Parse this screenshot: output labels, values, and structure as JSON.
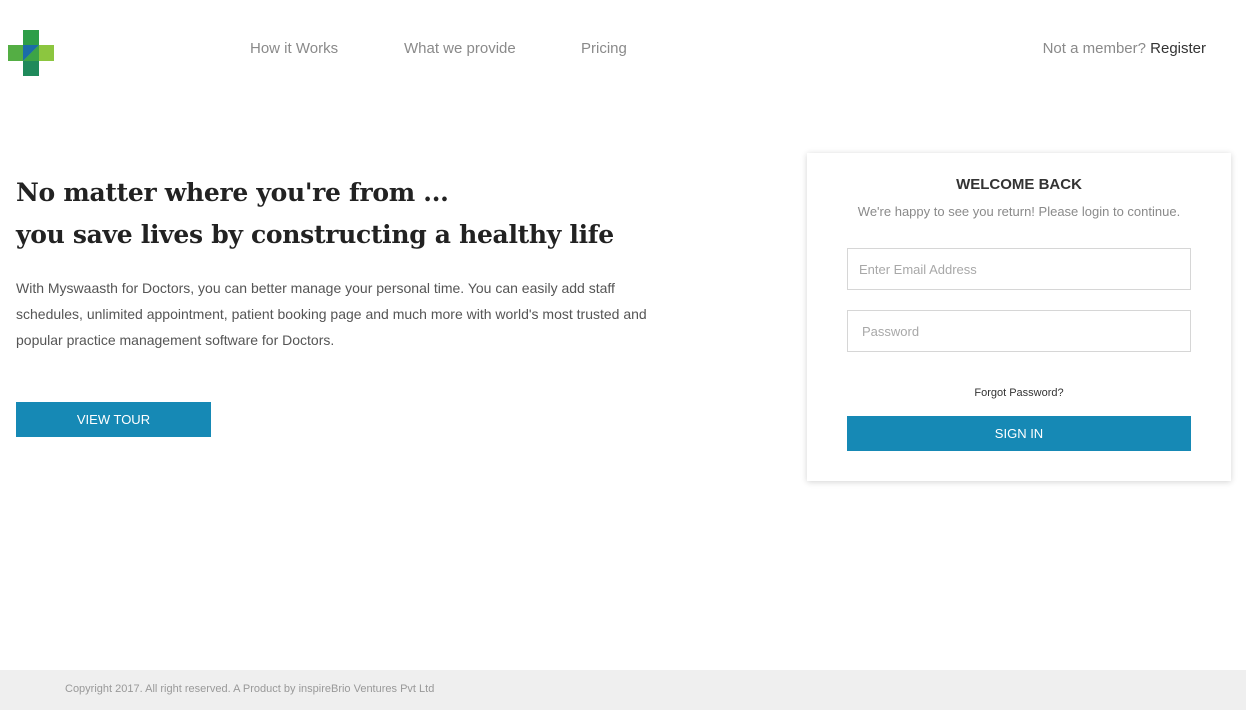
{
  "header": {
    "logo_name": "plus-cross-logo",
    "nav": {
      "how_it_works": "How it Works",
      "what_we_provide": "What we provide",
      "pricing": "Pricing"
    },
    "member_prompt": "Not a member?",
    "register_label": "Register"
  },
  "hero": {
    "title_line1": "No matter where you're from ...",
    "title_line2": "you save lives by constructing a healthy life",
    "description": "With Myswaasth for Doctors, you can better manage your personal time. You can easily add staff schedules, unlimited appointment, patient booking page and much more with world's most trusted and popular practice management software for Doctors.",
    "view_tour_label": "VIEW TOUR"
  },
  "login": {
    "title": "WELCOME BACK",
    "subtitle": "We're happy to see you return! Please login to continue.",
    "email_placeholder": "Enter Email Address",
    "password_placeholder": "Password",
    "forgot_label": "Forgot Password?",
    "sign_in_label": "SIGN IN"
  },
  "footer": {
    "copyright": "Copyright 2017. All right reserved. A Product by inspireBrio Ventures Pvt Ltd"
  },
  "colors": {
    "primary_button": "#1689b5",
    "logo_green_light": "#8cc63f",
    "logo_green_dark": "#2e9e48",
    "logo_blue": "#1b6ca8",
    "footer_bg": "#efefef"
  }
}
